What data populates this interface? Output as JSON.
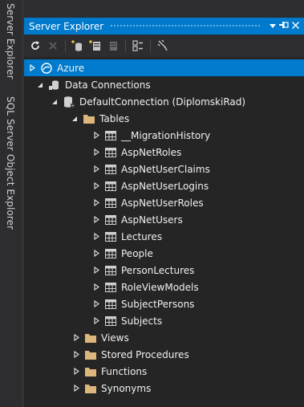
{
  "side_tabs": {
    "server_explorer": "Server Explorer",
    "sql_server_object_explorer": "SQL Server Object Explorer"
  },
  "panel": {
    "title": "Server Explorer",
    "pin_glyph": "▾",
    "autohide_glyph": "−᎐",
    "close_glyph": "✕"
  },
  "tree": {
    "azure": "Azure",
    "data_connections": "Data Connections",
    "default_connection": "DefaultConnection (DiplomskiRad)",
    "tables": "Tables",
    "table_items": [
      "__MigrationHistory",
      "AspNetRoles",
      "AspNetUserClaims",
      "AspNetUserLogins",
      "AspNetUserRoles",
      "AspNetUsers",
      "Lectures",
      "People",
      "PersonLectures",
      "RoleViewModels",
      "SubjectPersons",
      "Subjects"
    ],
    "views": "Views",
    "stored_procedures": "Stored Procedures",
    "functions": "Functions",
    "synonyms": "Synonyms"
  },
  "colors": {
    "accent": "#007acc",
    "background": "#252526",
    "folder": "#dcb67a"
  }
}
